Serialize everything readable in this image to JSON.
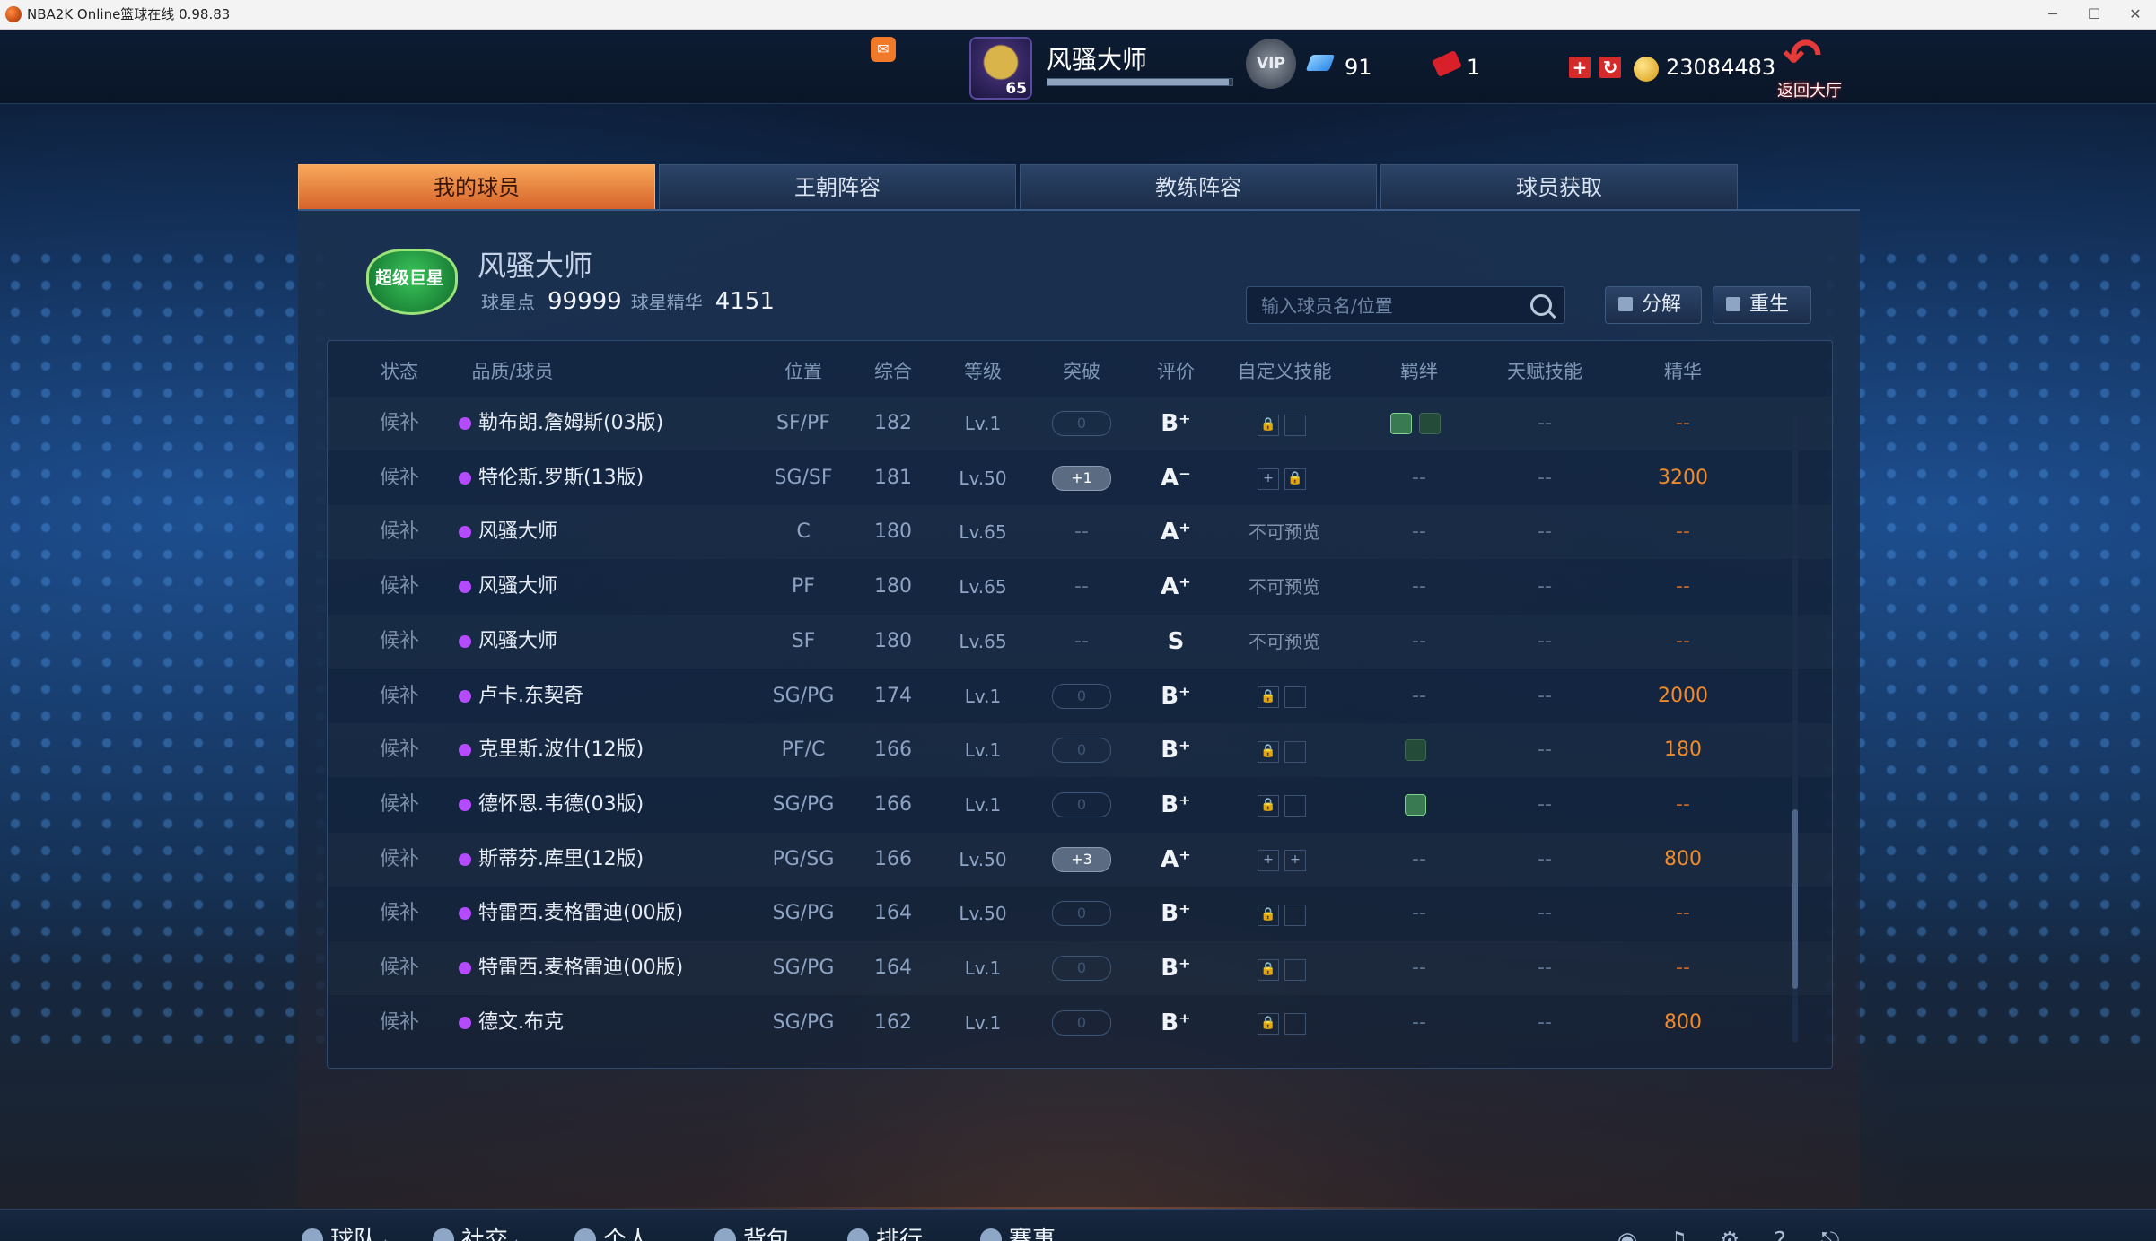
{
  "window": {
    "title": "NBA2K Online篮球在线 0.98.83"
  },
  "topbar": {
    "player_name": "风骚大师",
    "player_level": "65",
    "vip_label": "VIP",
    "gems": "91",
    "tickets": "1",
    "coins": "23084483",
    "back_label": "返回大厅",
    "exp_fraction": 0.98
  },
  "tabs": [
    "我的球员",
    "王朝阵容",
    "教练阵容",
    "球员获取"
  ],
  "club": {
    "emblem_text": "超级巨星",
    "name": "风骚大师",
    "star_points_label": "球星点",
    "star_points": "99999",
    "essence_label": "球星精华",
    "essence": "4151"
  },
  "search": {
    "placeholder": "输入球员名/位置"
  },
  "actions": {
    "decompose": "分解",
    "rebirth": "重生"
  },
  "columns": [
    "状态",
    "品质/球员",
    "位置",
    "综合",
    "等级",
    "突破",
    "评价",
    "自定义技能",
    "羁绊",
    "天赋技能",
    "精华"
  ],
  "rows": [
    {
      "status": "候补",
      "name": "勒布朗.詹姆斯(03版)",
      "pos": "SF/PF",
      "ovr": "182",
      "lvl": "Lv.1",
      "brk": "0",
      "grade": "B⁺",
      "skill": "lock",
      "bond": "2",
      "talent": "--",
      "ess": "--"
    },
    {
      "status": "候补",
      "name": "特伦斯.罗斯(13版)",
      "pos": "SG/SF",
      "ovr": "181",
      "lvl": "Lv.50",
      "brk": "+1",
      "grade": "A⁻",
      "skill": "plus-lock",
      "bond": "--",
      "talent": "--",
      "ess": "3200"
    },
    {
      "status": "候补",
      "name": "风骚大师",
      "pos": "C",
      "ovr": "180",
      "lvl": "Lv.65",
      "brk": "--",
      "grade": "A⁺",
      "skill": "不可预览",
      "bond": "--",
      "talent": "--",
      "ess": "--"
    },
    {
      "status": "候补",
      "name": "风骚大师",
      "pos": "PF",
      "ovr": "180",
      "lvl": "Lv.65",
      "brk": "--",
      "grade": "A⁺",
      "skill": "不可预览",
      "bond": "--",
      "talent": "--",
      "ess": "--"
    },
    {
      "status": "候补",
      "name": "风骚大师",
      "pos": "SF",
      "ovr": "180",
      "lvl": "Lv.65",
      "brk": "--",
      "grade": "S",
      "skill": "不可预览",
      "bond": "--",
      "talent": "--",
      "ess": "--"
    },
    {
      "status": "候补",
      "name": "卢卡.东契奇",
      "pos": "SG/PG",
      "ovr": "174",
      "lvl": "Lv.1",
      "brk": "0",
      "grade": "B⁺",
      "skill": "lock",
      "bond": "--",
      "talent": "--",
      "ess": "2000"
    },
    {
      "status": "候补",
      "name": "克里斯.波什(12版)",
      "pos": "PF/C",
      "ovr": "166",
      "lvl": "Lv.1",
      "brk": "0",
      "grade": "B⁺",
      "skill": "lock",
      "bond": "1dim",
      "talent": "--",
      "ess": "180"
    },
    {
      "status": "候补",
      "name": "德怀恩.韦德(03版)",
      "pos": "SG/PG",
      "ovr": "166",
      "lvl": "Lv.1",
      "brk": "0",
      "grade": "B⁺",
      "skill": "lock",
      "bond": "1",
      "talent": "--",
      "ess": "--"
    },
    {
      "status": "候补",
      "name": "斯蒂芬.库里(12版)",
      "pos": "PG/SG",
      "ovr": "166",
      "lvl": "Lv.50",
      "brk": "+3",
      "grade": "A⁺",
      "skill": "plus-plus",
      "bond": "--",
      "talent": "--",
      "ess": "800"
    },
    {
      "status": "候补",
      "name": "特雷西.麦格雷迪(00版)",
      "pos": "SG/PG",
      "ovr": "164",
      "lvl": "Lv.50",
      "brk": "0",
      "grade": "B⁺",
      "skill": "lock",
      "bond": "--",
      "talent": "--",
      "ess": "--"
    },
    {
      "status": "候补",
      "name": "特雷西.麦格雷迪(00版)",
      "pos": "SG/PG",
      "ovr": "164",
      "lvl": "Lv.1",
      "brk": "0",
      "grade": "B⁺",
      "skill": "lock",
      "bond": "--",
      "talent": "--",
      "ess": "--"
    },
    {
      "status": "候补",
      "name": "德文.布克",
      "pos": "SG/PG",
      "ovr": "162",
      "lvl": "Lv.1",
      "brk": "0",
      "grade": "B⁺",
      "skill": "lock",
      "bond": "--",
      "talent": "--",
      "ess": "800"
    }
  ],
  "bottom_nav": [
    "球队",
    "社交",
    "个人",
    "背包",
    "排行",
    "赛事"
  ],
  "colors": {
    "accent_orange": "#f08a2a",
    "tab_active": "#e07a3a",
    "quality_purple": "#b54bff"
  }
}
